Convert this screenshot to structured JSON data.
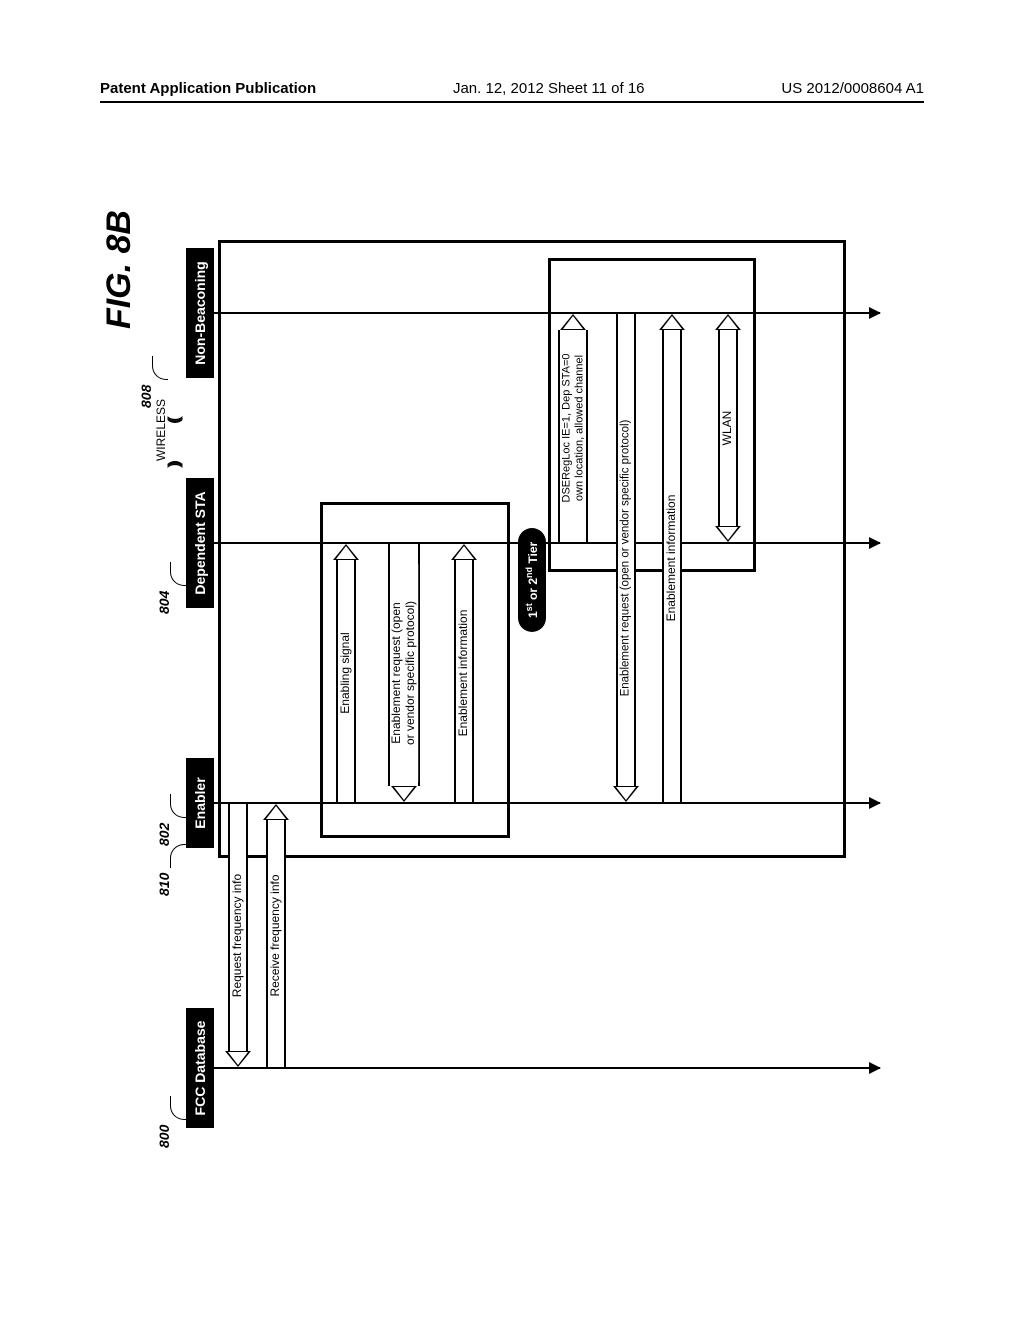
{
  "header": {
    "left": "Patent Application Publication",
    "center": "Jan. 12, 2012  Sheet 11 of 16",
    "right": "US 2012/0008604 A1"
  },
  "figure": {
    "title": "FIG. 8B"
  },
  "refs": {
    "r800": "800",
    "r802": "802",
    "r804": "804",
    "r808": "808",
    "r810": "810"
  },
  "actors": {
    "fcc": "FCC Database",
    "enabler": "Enabler",
    "dependent": "Dependent STA",
    "nonbeacon": "Non-Beaconing",
    "wireless": "WIRELESS"
  },
  "messages": {
    "req_freq": "Request frequency info",
    "recv_freq": "Receive frequency info",
    "enabling_signal": "Enabling signal",
    "enable_req_1": "Enablement request (open\nor vendor specific protocol)",
    "enable_info_1": "Enablement information",
    "dseregloc": "DSERegLoc IE=1, Dep STA=0\nown location, allowed channel",
    "enable_req_2": "Enablement request (open or vendor specific protocol)",
    "enable_info_2": "Enablement information",
    "wlan": "WLAN"
  },
  "badge": {
    "tier": "1st or 2nd Tier"
  }
}
